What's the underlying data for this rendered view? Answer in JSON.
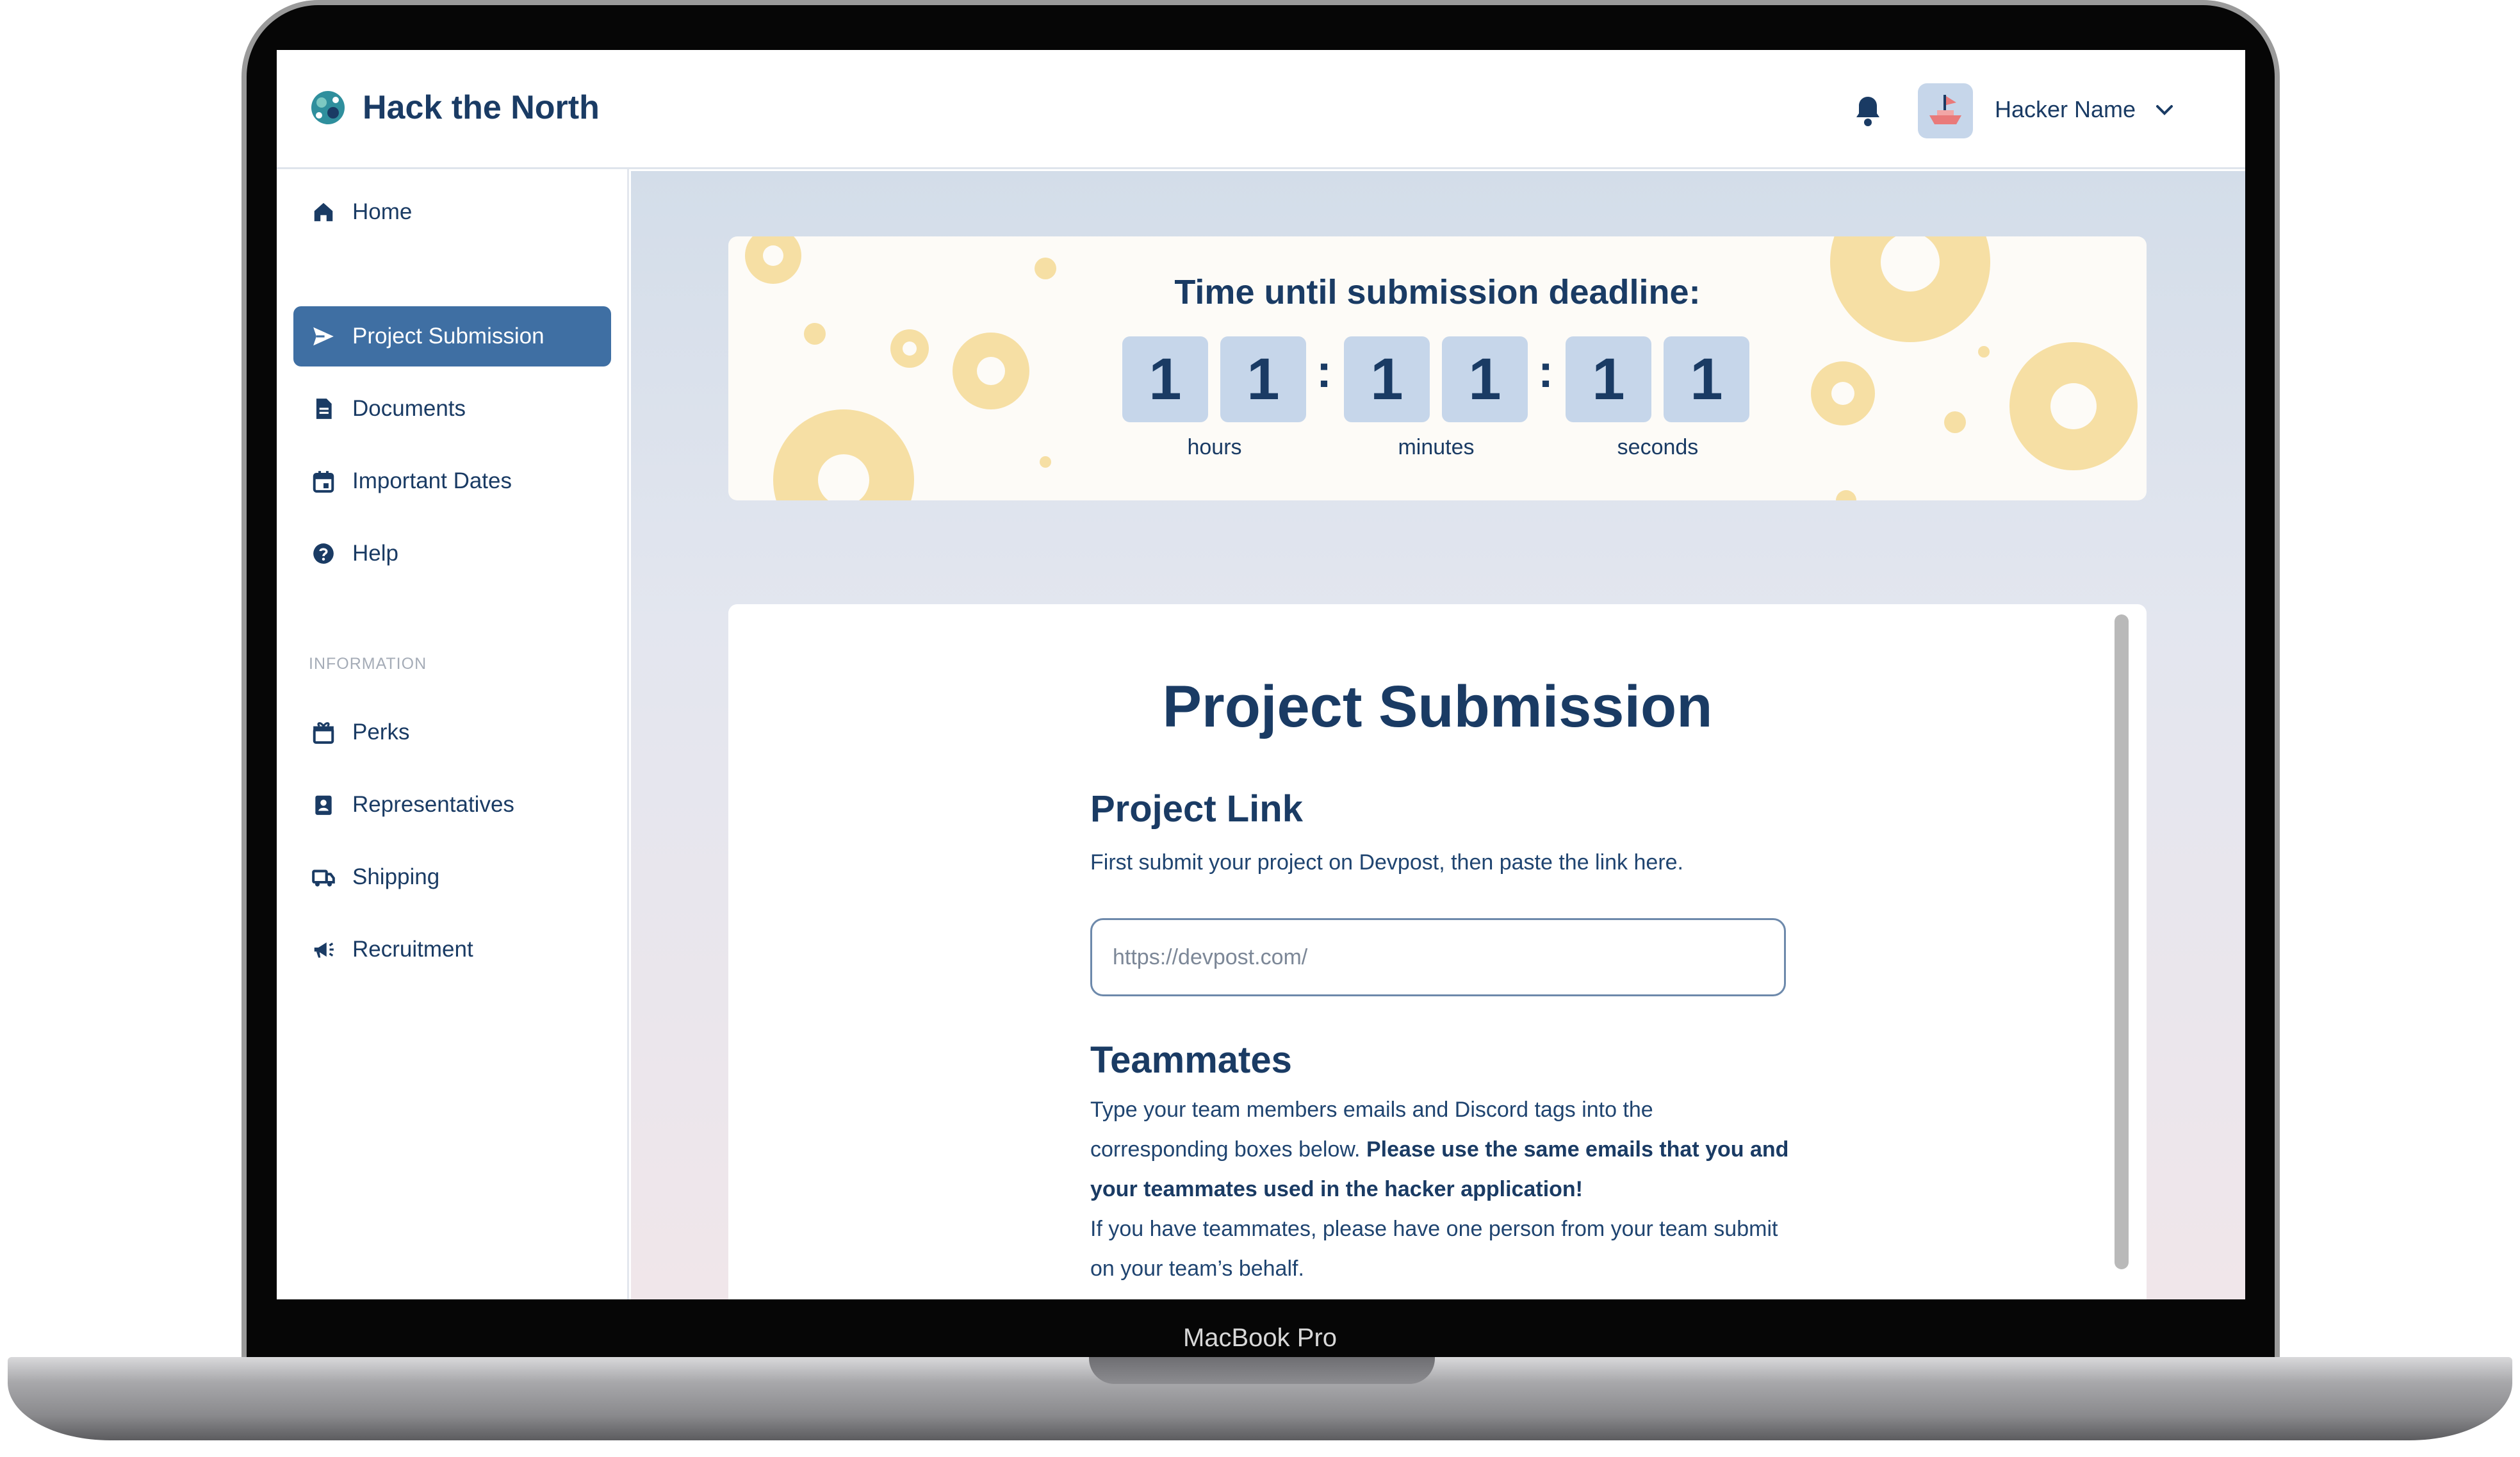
{
  "device": {
    "label": "MacBook Pro"
  },
  "header": {
    "brand_name": "Hack the North",
    "user_name": "Hacker Name"
  },
  "sidebar": {
    "items": [
      {
        "label": "Home",
        "icon": "home-icon"
      },
      {
        "label": "Project Submission",
        "icon": "send-icon",
        "active": true
      },
      {
        "label": "Documents",
        "icon": "document-icon"
      },
      {
        "label": "Important Dates",
        "icon": "calendar-icon"
      },
      {
        "label": "Help",
        "icon": "help-icon"
      }
    ],
    "section_label": "INFORMATION",
    "info_items": [
      {
        "label": "Perks",
        "icon": "gift-icon"
      },
      {
        "label": "Representatives",
        "icon": "badge-icon"
      },
      {
        "label": "Shipping",
        "icon": "truck-icon"
      },
      {
        "label": "Recruitment",
        "icon": "megaphone-icon"
      }
    ]
  },
  "countdown": {
    "title": "Time until submission deadline:",
    "hours": [
      "1",
      "1"
    ],
    "minutes": [
      "1",
      "1"
    ],
    "seconds": [
      "1",
      "1"
    ],
    "hours_label": "hours",
    "minutes_label": "minutes",
    "seconds_label": "seconds",
    "separator": ":"
  },
  "submission": {
    "title": "Project Submission",
    "link_heading": "Project Link",
    "link_help": "First submit your project on Devpost, then paste the link here.",
    "link_placeholder": "https://devpost.com/",
    "teammates_heading": "Teammates",
    "teammates_text_1": "Type your team members emails and Discord tags into the corresponding boxes below.",
    "teammates_text_bold": "Please use the same emails that you and your teammates used in the hacker application!",
    "teammates_text_2": "If you have teammates, please have one person from your team submit on your team’s behalf."
  },
  "colors": {
    "primary": "#1a3b64",
    "active_nav": "#3f6fa3",
    "digit_bg": "#c6d6ea",
    "gear": "#f6dfa4"
  }
}
